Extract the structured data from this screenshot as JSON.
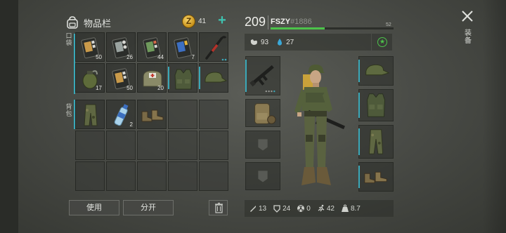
{
  "inventory": {
    "title": "物品栏",
    "coins": "41",
    "pocket_label": "口袋",
    "backpack_label": "背包"
  },
  "pocket_items": [
    {
      "name": "pills-pack",
      "qty": "50"
    },
    {
      "name": "pills-pack",
      "qty": "26"
    },
    {
      "name": "pills-pack",
      "qty": "44"
    },
    {
      "name": "pills-pack",
      "qty": "7"
    },
    {
      "name": "crowbar",
      "qty": ""
    },
    {
      "name": "grenade",
      "qty": "17"
    },
    {
      "name": "pills-pack",
      "qty": "50"
    },
    {
      "name": "medkit-bag",
      "qty": "20"
    },
    {
      "name": "tactical-vest",
      "qty": ""
    },
    {
      "name": "military-cap",
      "qty": ""
    }
  ],
  "backpack_items": [
    {
      "name": "camo-pants",
      "qty": ""
    },
    {
      "name": "water-bottle",
      "qty": "2"
    },
    {
      "name": "boots",
      "qty": ""
    }
  ],
  "buttons": {
    "use": "使用",
    "split": "分开"
  },
  "player": {
    "level": "209",
    "name": "FSZY",
    "id": "#1886",
    "xp_value": "52",
    "xp_fraction": 0.44,
    "hunger": "93",
    "thirst": "27"
  },
  "stats": {
    "attack": "13",
    "defense": "24",
    "radiation": "0",
    "speed": "42",
    "weight": "8.7"
  },
  "side_tag": "装备",
  "colors": {
    "accent": "#3aa8b8",
    "xp": "#4cc34a",
    "coin": "#e0a82a"
  }
}
